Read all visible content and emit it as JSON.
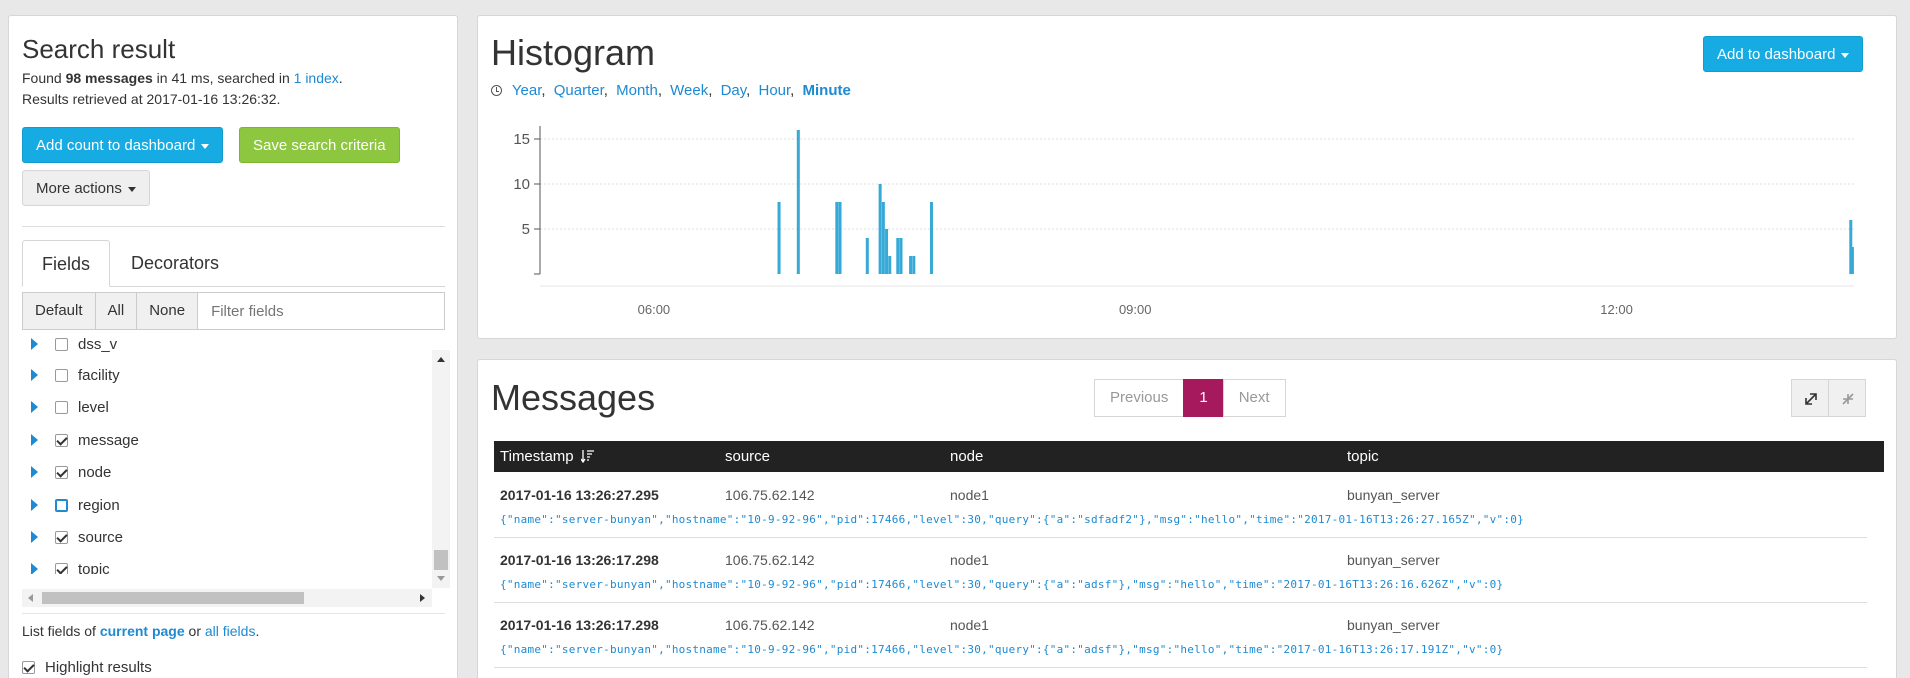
{
  "search": {
    "title": "Search result",
    "found_prefix": "Found ",
    "count": "98 messages",
    "found_middle": " in 41 ms, searched in ",
    "index_link": "1 index",
    "found_suffix": ".",
    "retrieved": "Results retrieved at 2017-01-16 13:26:32.",
    "add_count_label": "Add count to dashboard",
    "save_label": "Save search criteria",
    "more_actions_label": "More actions"
  },
  "tabs": {
    "fields": "Fields",
    "decorators": "Decorators"
  },
  "filter": {
    "default_label": "Default",
    "all_label": "All",
    "none_label": "None",
    "placeholder": "Filter fields"
  },
  "fields": [
    {
      "name": "dss_v",
      "checked": false
    },
    {
      "name": "facility",
      "checked": false
    },
    {
      "name": "level",
      "checked": false
    },
    {
      "name": "message",
      "checked": true
    },
    {
      "name": "node",
      "checked": true
    },
    {
      "name": "region",
      "checked": false
    },
    {
      "name": "source",
      "checked": true
    },
    {
      "name": "topic",
      "checked": true
    }
  ],
  "list_fields": {
    "prefix": "List fields of ",
    "current_page": "current page",
    "middle": " or ",
    "all_fields": "all fields",
    "suffix": "."
  },
  "highlight_label": "Highlight results",
  "histogram": {
    "title": "Histogram",
    "add_label": "Add to dashboard",
    "resolutions": [
      "Year",
      "Quarter",
      "Month",
      "Week",
      "Day",
      "Hour",
      "Minute"
    ],
    "active_resolution": "Minute"
  },
  "chart_data": {
    "type": "bar",
    "x_ticks": [
      "06:00",
      "09:00",
      "12:00"
    ],
    "y_ticks": [
      5,
      10,
      15
    ],
    "ylim": [
      0,
      16
    ],
    "x_range_hours": [
      5.29,
      13.48
    ],
    "bars": [
      {
        "t": 6.78,
        "v": 8
      },
      {
        "t": 6.9,
        "v": 16
      },
      {
        "t": 7.14,
        "v": 8
      },
      {
        "t": 7.16,
        "v": 8
      },
      {
        "t": 7.33,
        "v": 4
      },
      {
        "t": 7.41,
        "v": 10
      },
      {
        "t": 7.43,
        "v": 8
      },
      {
        "t": 7.45,
        "v": 5
      },
      {
        "t": 7.47,
        "v": 2
      },
      {
        "t": 7.52,
        "v": 4
      },
      {
        "t": 7.54,
        "v": 4
      },
      {
        "t": 7.6,
        "v": 2
      },
      {
        "t": 7.62,
        "v": 2
      },
      {
        "t": 7.73,
        "v": 8
      },
      {
        "t": 13.46,
        "v": 6
      },
      {
        "t": 13.47,
        "v": 3
      }
    ],
    "bar_color": "#36a9d6",
    "grid": true
  },
  "messages": {
    "title": "Messages",
    "prev_label": "Previous",
    "page": "1",
    "next_label": "Next",
    "columns": [
      "Timestamp",
      "source",
      "node",
      "topic"
    ],
    "rows": [
      {
        "timestamp": "2017-01-16 13:26:27.295",
        "source": "106.75.62.142",
        "node": "node1",
        "topic": "bunyan_server",
        "message": "{\"name\":\"server-bunyan\",\"hostname\":\"10-9-92-96\",\"pid\":17466,\"level\":30,\"query\":{\"a\":\"sdfadf2\"},\"msg\":\"hello\",\"time\":\"2017-01-16T13:26:27.165Z\",\"v\":0}"
      },
      {
        "timestamp": "2017-01-16 13:26:17.298",
        "source": "106.75.62.142",
        "node": "node1",
        "topic": "bunyan_server",
        "message": "{\"name\":\"server-bunyan\",\"hostname\":\"10-9-92-96\",\"pid\":17466,\"level\":30,\"query\":{\"a\":\"adsf\"},\"msg\":\"hello\",\"time\":\"2017-01-16T13:26:16.626Z\",\"v\":0}"
      },
      {
        "timestamp": "2017-01-16 13:26:17.298",
        "source": "106.75.62.142",
        "node": "node1",
        "topic": "bunyan_server",
        "message": "{\"name\":\"server-bunyan\",\"hostname\":\"10-9-92-96\",\"pid\":17466,\"level\":30,\"query\":{\"a\":\"adsf\"},\"msg\":\"hello\",\"time\":\"2017-01-16T13:26:17.191Z\",\"v\":0}"
      }
    ]
  }
}
